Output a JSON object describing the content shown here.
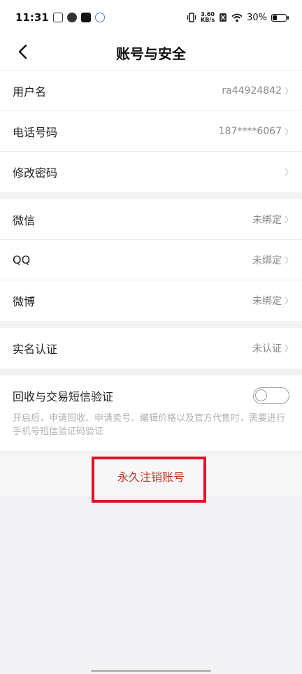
{
  "status_bar": {
    "time": "11:31",
    "net_speed_value": "3.60",
    "net_speed_unit": "KB/s",
    "battery": "30%",
    "battery_level": 0.3
  },
  "nav": {
    "title": "账号与安全"
  },
  "account_group": [
    {
      "label": "用户名",
      "value": "ra44924842"
    },
    {
      "label": "电话号码",
      "value": "187****6067"
    },
    {
      "label": "修改密码",
      "value": ""
    }
  ],
  "social_group": [
    {
      "label": "微信",
      "value": "未绑定"
    },
    {
      "label": "QQ",
      "value": "未绑定"
    },
    {
      "label": "微博",
      "value": "未绑定"
    }
  ],
  "verify_group": [
    {
      "label": "实名认证",
      "value": "未认证"
    }
  ],
  "sms_verify": {
    "label": "回收与交易短信验证",
    "enabled": false,
    "description": "开启后，申请回收、申请卖号、编辑价格以及官方代售时，需要进行手机号短信验证码验证"
  },
  "delete_account": {
    "label": "永久注销账号"
  },
  "colors": {
    "danger": "#c0392b",
    "highlight_border": "#e0102a"
  }
}
